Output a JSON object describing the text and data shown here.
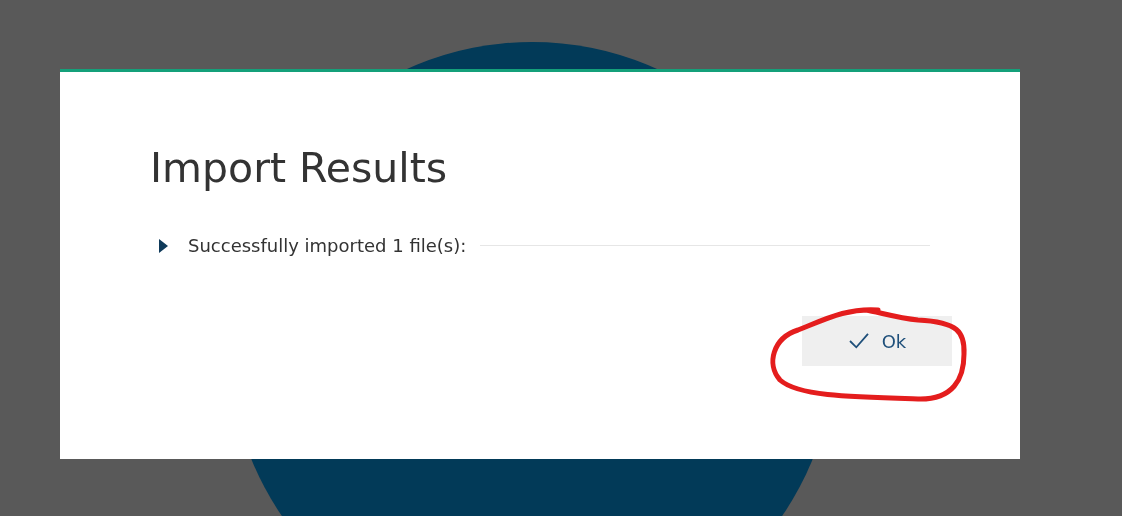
{
  "dialog": {
    "title": "Import Results",
    "results": [
      {
        "label": "Successfully imported 1 file(s):",
        "expanded": false
      }
    ],
    "buttons": [
      {
        "label": "Ok",
        "kind": "confirm"
      }
    ]
  }
}
